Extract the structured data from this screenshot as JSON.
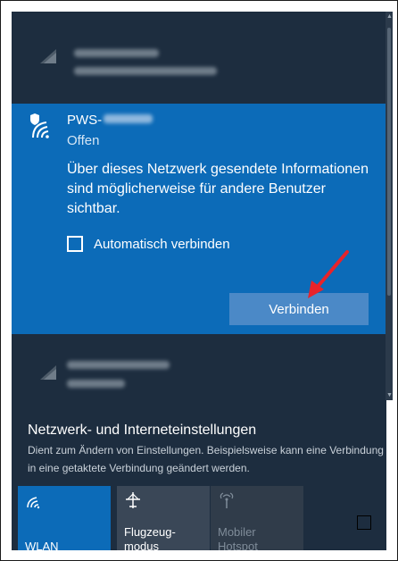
{
  "networks": [
    {
      "icon": "wifi-signal-icon"
    },
    {
      "icon": "wifi-signal-icon"
    }
  ],
  "selected_network": {
    "icon": "wifi-shield-icon",
    "ssid": "PWS-",
    "status": "Offen",
    "warning": "Über dieses Netzwerk gesendete Informationen sind möglicherweise für andere Benutzer sichtbar.",
    "auto_connect_label": "Automatisch verbinden",
    "auto_connect_checked": false,
    "connect_label": "Verbinden"
  },
  "settings": {
    "title": "Netzwerk- und Interneteinstellungen",
    "description": "Dient zum Ändern von Einstellungen. Beispielsweise kann eine Verbindung in eine getaktete Verbindung geändert werden."
  },
  "quick_actions": [
    {
      "label": "WLAN",
      "icon": "wifi-icon",
      "active": true
    },
    {
      "label_line1": "Flugzeug-",
      "label_line2": "modus",
      "icon": "airplane-icon",
      "active": false
    },
    {
      "label_line1": "Mobiler",
      "label_line2": "Hotspot",
      "icon": "hotspot-icon",
      "active": false
    }
  ],
  "colors": {
    "panel_bg": "#1d2d3f",
    "accent": "#0c6bb8",
    "button": "#4b89c7",
    "annotation_arrow": "#e8232a"
  }
}
